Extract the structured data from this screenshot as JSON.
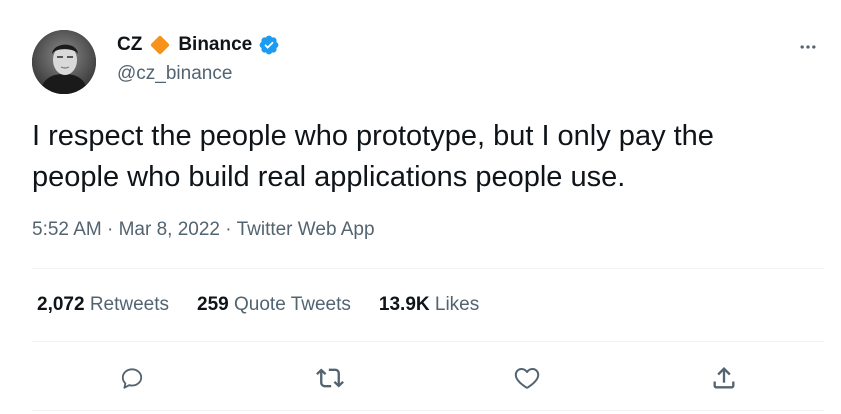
{
  "author": {
    "display_name": "CZ",
    "affiliation": "Binance",
    "handle": "@cz_binance",
    "verified": true
  },
  "tweet": {
    "text_line1": "I respect the people who prototype, but I only pay the",
    "text_line2": "people who build real applications people use.",
    "time": "5:52 AM",
    "date": "Mar 8, 2022",
    "source": "Twitter Web App",
    "separator": "·"
  },
  "stats": {
    "retweets_count": "2,072",
    "retweets_label": "Retweets",
    "quotes_count": "259",
    "quotes_label": "Quote Tweets",
    "likes_count": "13.9K",
    "likes_label": "Likes"
  },
  "icons": {
    "reply": "reply-icon",
    "retweet": "retweet-icon",
    "like": "heart-icon",
    "share": "share-icon",
    "more": "more-icon",
    "verified": "verified-badge-icon",
    "brand": "binance-diamond-icon"
  },
  "colors": {
    "primary_text": "#0f1419",
    "secondary_text": "#536471",
    "verified_blue": "#1d9bf0",
    "binance_orange": "#f7931a",
    "divider": "#eff3f4"
  }
}
